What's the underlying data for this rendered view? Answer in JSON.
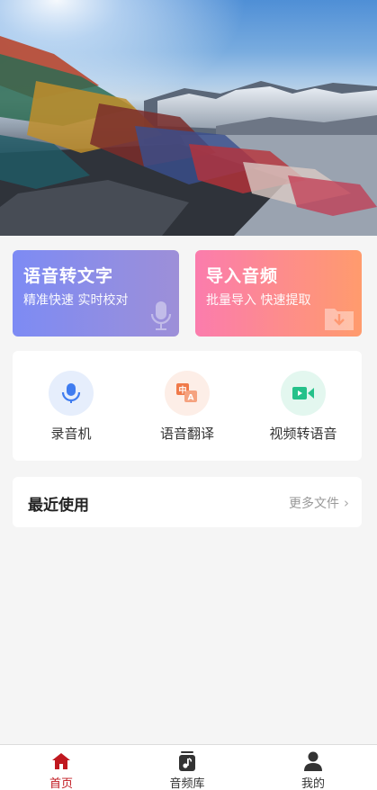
{
  "hero": {
    "image": "mountain-prayer-flags-banner"
  },
  "cards": [
    {
      "title": "语音转文字",
      "subtitle": "精准快速 实时校对",
      "icon": "microphone-icon"
    },
    {
      "title": "导入音频",
      "subtitle": "批量导入 快速提取",
      "icon": "folder-download-icon"
    }
  ],
  "tools": [
    {
      "label": "录音机",
      "icon": "microphone-icon",
      "color": "#3f7cf0"
    },
    {
      "label": "语音翻译",
      "icon": "translate-icon",
      "color": "#f07a4a"
    },
    {
      "label": "视频转语音",
      "icon": "video-camera-icon",
      "color": "#25c18a"
    }
  ],
  "recent": {
    "title": "最近使用",
    "more": "更多文件"
  },
  "tabs": [
    {
      "label": "首页",
      "icon": "home-icon",
      "active": true
    },
    {
      "label": "音频库",
      "icon": "music-library-icon",
      "active": false
    },
    {
      "label": "我的",
      "icon": "user-icon",
      "active": false
    }
  ],
  "colors": {
    "accent": "#c0181f",
    "background": "#f5f5f5"
  }
}
